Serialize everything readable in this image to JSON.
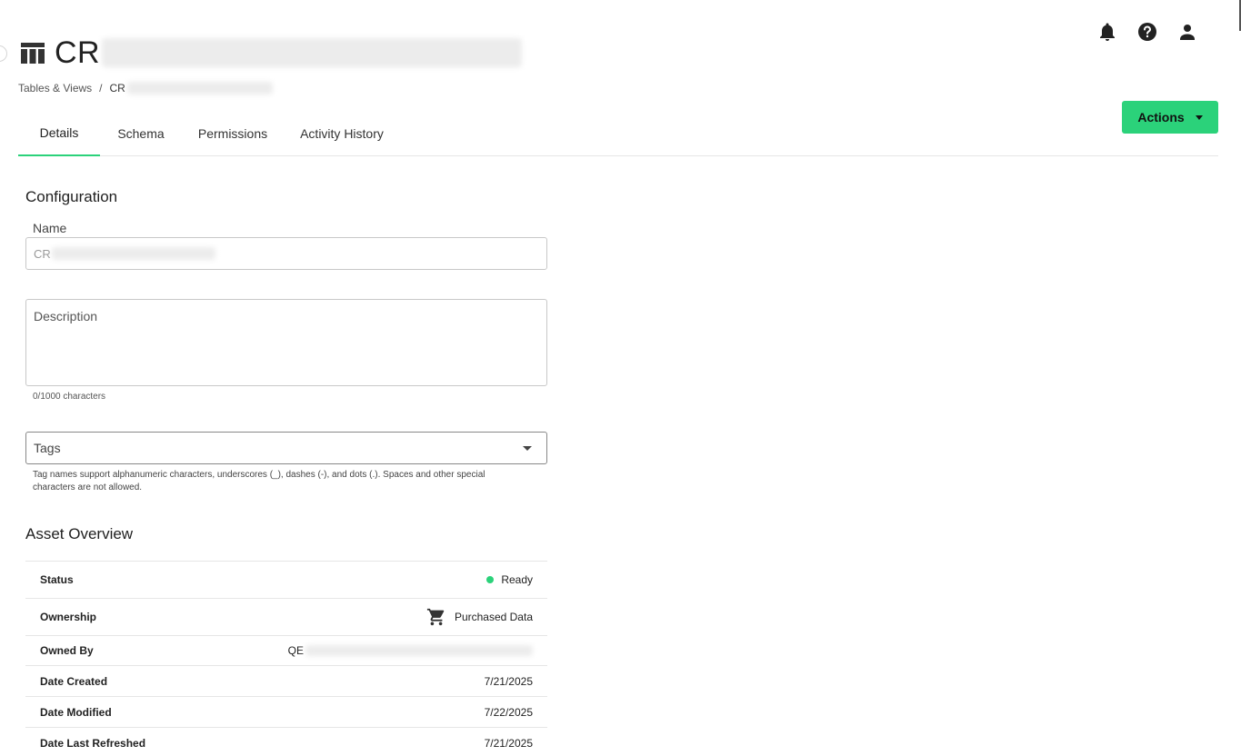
{
  "header": {
    "title_prefix": "CR",
    "breadcrumb": {
      "root": "Tables & Views",
      "separator": "/",
      "current_prefix": "CR"
    },
    "icons": [
      "bell-icon",
      "help-icon",
      "account-icon"
    ]
  },
  "actions": {
    "label": "Actions"
  },
  "tabs": [
    {
      "label": "Details",
      "active": true
    },
    {
      "label": "Schema",
      "active": false
    },
    {
      "label": "Permissions",
      "active": false
    },
    {
      "label": "Activity History",
      "active": false
    }
  ],
  "configuration": {
    "title": "Configuration",
    "name_label": "Name",
    "name_value_prefix": "CR",
    "description_label": "Description",
    "char_count": "0/1000 characters",
    "tags_label": "Tags",
    "tags_help": "Tag names support alphanumeric characters, underscores (_), dashes (-), and dots (.). Spaces and other special characters are not allowed."
  },
  "asset_overview": {
    "title": "Asset Overview",
    "rows": [
      {
        "key": "Status",
        "value": "Ready"
      },
      {
        "key": "Ownership",
        "value": "Purchased Data"
      },
      {
        "key": "Owned By",
        "value": "QE"
      },
      {
        "key": "Date Created",
        "value": "7/21/2025"
      },
      {
        "key": "Date Modified",
        "value": "7/22/2025"
      },
      {
        "key": "Date Last Refreshed",
        "value": "7/21/2025"
      }
    ]
  },
  "colors": {
    "accent": "#2bd27a",
    "status_ready": "#2bd27a",
    "border": "#c8c8c8"
  }
}
